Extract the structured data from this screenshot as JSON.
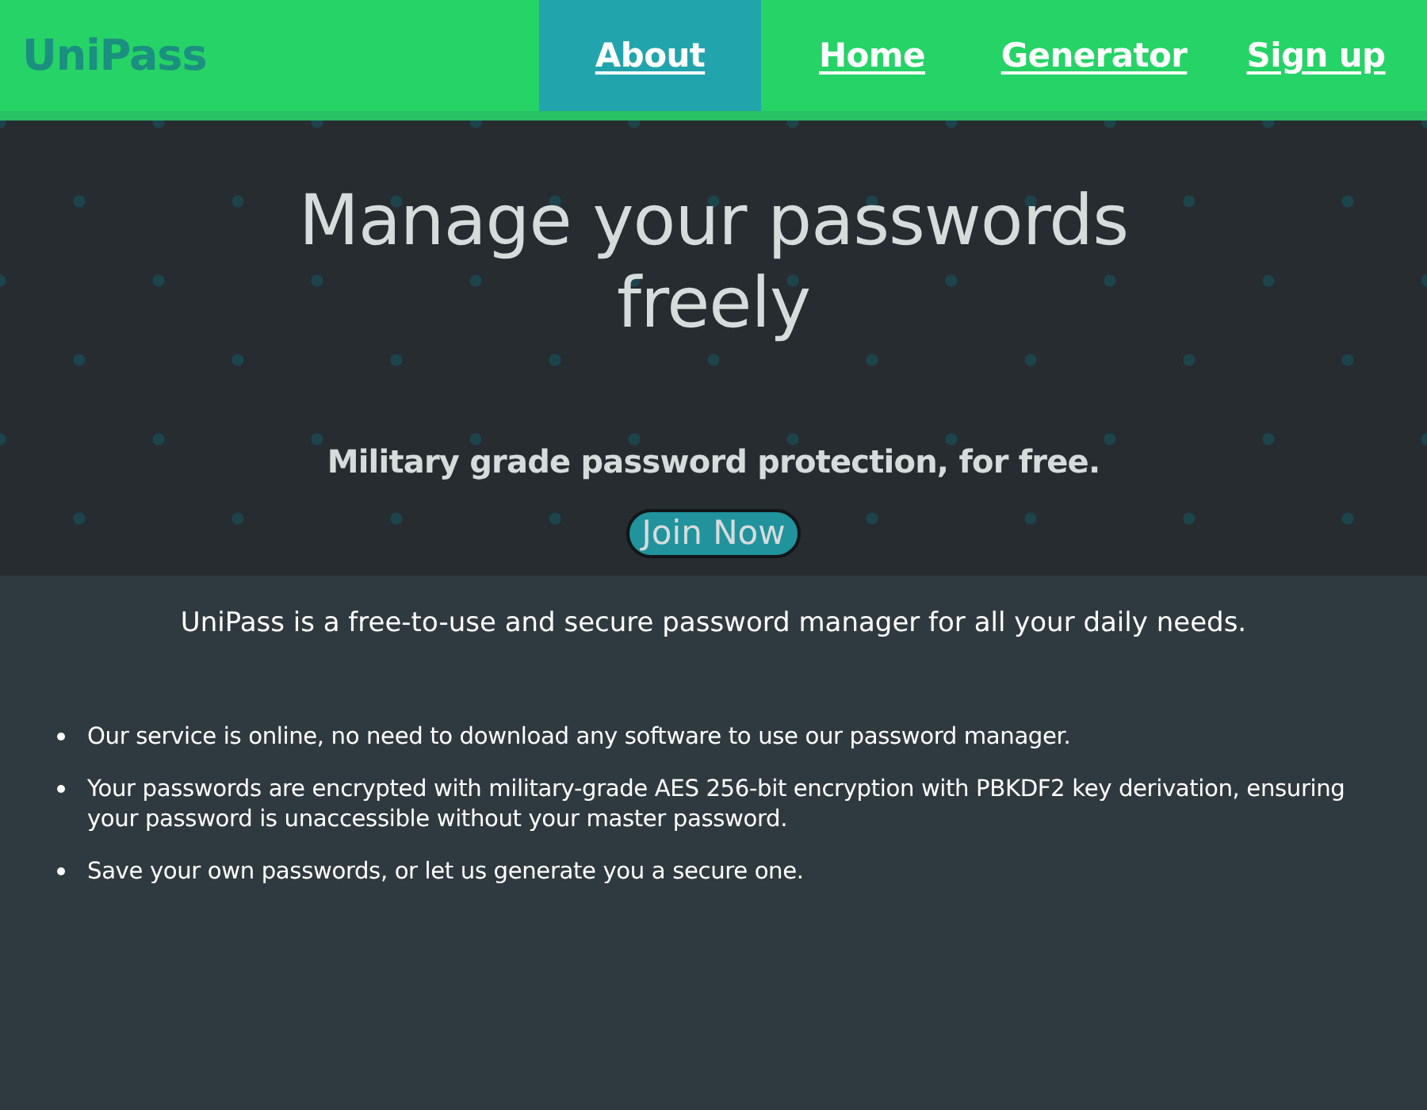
{
  "nav": {
    "logo": "UniPass",
    "links": [
      {
        "label": "About",
        "selected": true
      },
      {
        "label": "Home",
        "selected": false
      },
      {
        "label": "Generator",
        "selected": false
      },
      {
        "label": "Sign up",
        "selected": false
      }
    ]
  },
  "hero": {
    "title": "Manage your passwords freely",
    "subtitle": "Military grade password protection, for free.",
    "cta": "Join Now"
  },
  "intro": "UniPass is a free-to-use and secure password manager for all your daily needs.",
  "features": [
    "Our service is online, no need to download any software to use our password manager.",
    "Your passwords are encrypted with military-grade AES 256-bit encryption with PBKDF2 key derivation, ensuring your password is unaccessible without your master password.",
    "Save your own passwords, or let us generate you a secure one."
  ]
}
